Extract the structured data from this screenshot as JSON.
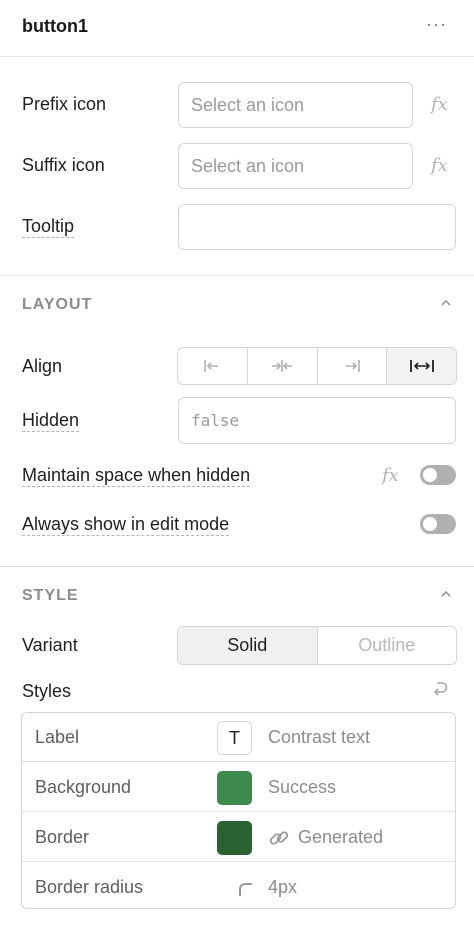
{
  "header": {
    "title": "button1",
    "more_label": "···"
  },
  "content": {
    "prefix_icon": {
      "label": "Prefix icon",
      "placeholder": "Select an icon"
    },
    "suffix_icon": {
      "label": "Suffix icon",
      "placeholder": "Select an icon"
    },
    "tooltip": {
      "label": "Tooltip",
      "value": ""
    },
    "fx_label": "fx"
  },
  "layout": {
    "title": "LAYOUT",
    "align": {
      "label": "Align",
      "options": [
        "align-left-icon",
        "align-center-icon",
        "align-right-icon",
        "align-stretch-icon"
      ],
      "selected_index": 3
    },
    "hidden": {
      "label": "Hidden",
      "value": "false"
    },
    "maintain_space": {
      "label": "Maintain space when hidden",
      "enabled": false
    },
    "always_show": {
      "label": "Always show in edit mode",
      "enabled": false
    }
  },
  "style": {
    "title": "STYLE",
    "variant": {
      "label": "Variant",
      "options": [
        "Solid",
        "Outline"
      ],
      "selected": "Solid"
    },
    "styles_label": "Styles",
    "rows": [
      {
        "label": "Label",
        "swatch_text": "T",
        "value": "Contrast text"
      },
      {
        "label": "Background",
        "swatch_color": "#3c8a4e",
        "value": "Success"
      },
      {
        "label": "Border",
        "swatch_color": "#2b6231",
        "value": "Generated"
      },
      {
        "label": "Border radius",
        "value": "4px"
      }
    ]
  },
  "colors": {
    "success": "#3c8a4e",
    "border_generated": "#2b6231",
    "toggle_off": "#b0b0b0"
  }
}
